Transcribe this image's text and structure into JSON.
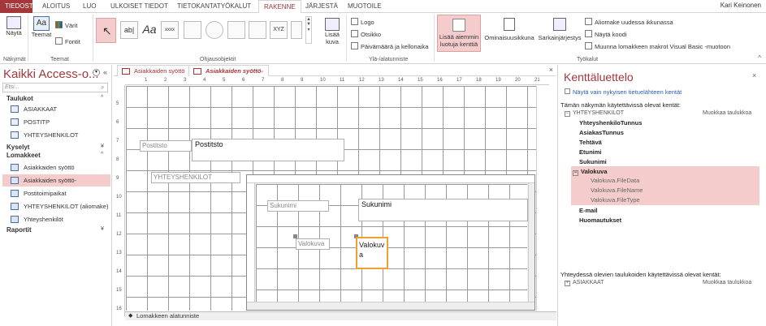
{
  "tabs": {
    "file": "TIEDOSTO",
    "home": "ALOITUS",
    "create": "LUO",
    "external": "ULKOISET TIEDOT",
    "dbtools": "TIETOKANTATYÖKALUT",
    "design": "RAKENNE",
    "arrange": "JÄRJESTÄ",
    "format": "MUOTOILE"
  },
  "user": "Kari Keinonen",
  "ribbon": {
    "view_label": "Näytä",
    "views_group": "Näkymät",
    "themes_label": "Teemat",
    "colors_label": "Värit",
    "fonts_label": "Fontit",
    "themes_group": "Teemat",
    "controls_group": "Ohjausobjektit",
    "controls_icons": [
      "ab|",
      "Aa",
      "xxxx",
      "XYZ"
    ],
    "insert_image": "Lisää",
    "insert_image2": "kuva",
    "logo": "Logo",
    "title": "Otsikko",
    "datetime": "Päivämäärä ja kellonaika",
    "header_group": "Ylä-/alatunniste",
    "add_fields": "Lisää aiemmin",
    "add_fields2": "luotuja kenttiä",
    "property_sheet": "Ominaisuusikkuna",
    "tab_order": "Sarkainjärjestys",
    "subform_new": "Aliomake uudessa ikkunassa",
    "view_code": "Näytä koodi",
    "convert_macros": "Muunna lomakkeen makrot Visual Basic -muotoon",
    "tools_group": "Työkalut"
  },
  "nav": {
    "title": "Kaikki Access-o...",
    "search_placeholder": "Etsi...",
    "groups": {
      "tables": "Taulukot",
      "queries": "Kyselyt",
      "forms": "Lomakkeet",
      "reports": "Raportit"
    },
    "tables": [
      "ASIAKKAAT",
      "POSTITP",
      "YHTEYSHENKILOT"
    ],
    "forms": [
      "Asiakkaiden syöttö",
      "Asiakkaiden syöttö-",
      "Postitoimipaikat",
      "YHTEYSHENKILOT (aliomake)",
      "Yhteyshenkilöt"
    ]
  },
  "doc_tabs": [
    "Asiakkaiden syöttö",
    "Asiakkaiden syöttö-"
  ],
  "design": {
    "postitsto_label": "Postitsto",
    "postitsto_field": "Postitsto",
    "yhteys_label": "YHTEYSHENKILOT",
    "sukunimi_label": "Sukunimi",
    "sukunimi_field": "Sukunimi",
    "valokuva_label": "Valokuva",
    "valokuva_field_1": "Valokuv",
    "valokuva_field_2": "a",
    "footer": "Lomakkeen alatunniste",
    "ruler_numbers": [
      "1",
      "2",
      "3",
      "4",
      "5",
      "6",
      "7",
      "8",
      "9",
      "10",
      "11",
      "12",
      "13",
      "14",
      "15",
      "16",
      "17",
      "18",
      "19",
      "20",
      "21"
    ],
    "vruler_numbers": [
      "5",
      "6",
      "7",
      "8",
      "9",
      "10",
      "11",
      "12",
      "13",
      "14",
      "15",
      "16"
    ]
  },
  "fieldlist": {
    "title": "Kenttäluettelo",
    "show_only": "Näytä vain nykyisen tietuelähteen kentät",
    "available": "Tämän näkymän käytettävissä olevat kentät:",
    "table": "YHTEYSHENKILOT",
    "edit_table": "Muokkaa taulukkoa",
    "fields_top": [
      "YhteyshenkiloTunnus",
      "AsiakasTunnus",
      "Tehtävä",
      "Etunimi",
      "Sukunimi"
    ],
    "valokuva": "Valokuva",
    "valokuva_sub": [
      "Valokuva.FileData",
      "Valokuva.FileName",
      "Valokuva.FileType"
    ],
    "fields_bottom": [
      "E-mail",
      "Huomautukset"
    ],
    "related": "Yhteydessä olevien taulukoiden käytettävissä olevat kentät:",
    "related_table": "ASIAKKAAT",
    "edit_table2": "Muokkaa taulukkoa"
  },
  "colors": {
    "accent": "#a4373a",
    "highlight": "#f4cccc"
  }
}
